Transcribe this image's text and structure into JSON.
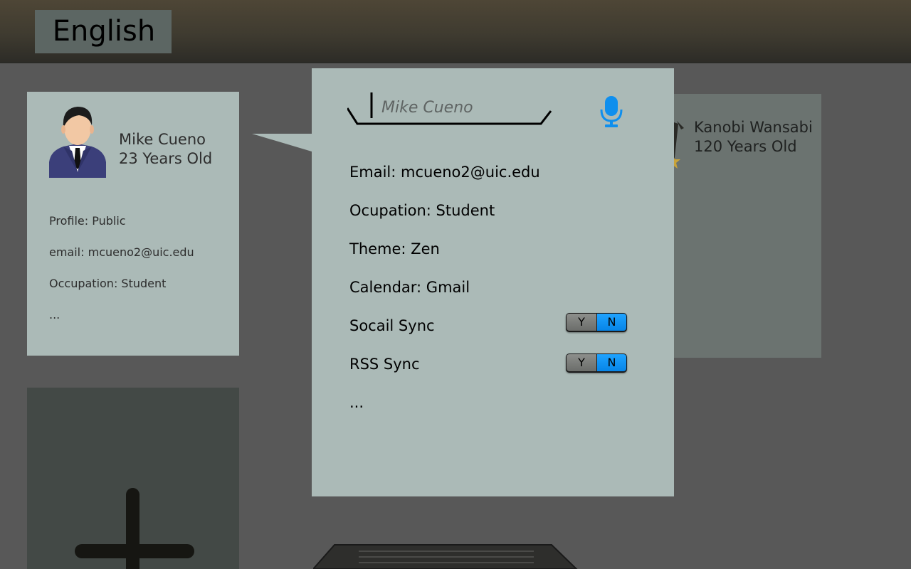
{
  "header": {
    "language_button": "English"
  },
  "user_card": {
    "name": "Mike Cueno",
    "age": "23 Years Old",
    "details": [
      "Profile: Public",
      "email: mcueno2@uic.edu",
      "Occupation: Student",
      "..."
    ]
  },
  "other_card": {
    "name": "Kanobi Wansabi",
    "age": "120 Years Old"
  },
  "edit_panel": {
    "name_input": {
      "placeholder": "Mike Cueno",
      "value": ""
    },
    "mic_icon": "microphone-icon",
    "fields": {
      "email": "Email: mcueno2@uic.edu",
      "occupation": "Ocupation: Student",
      "theme": "Theme: Zen",
      "calendar": "Calendar: Gmail",
      "more": "..."
    },
    "toggles": [
      {
        "label": "Socail Sync",
        "yes": "Y",
        "no": "N",
        "selected": "N"
      },
      {
        "label": "RSS Sync",
        "yes": "Y",
        "no": "N",
        "selected": "N"
      }
    ]
  },
  "add_card": {
    "icon": "plus-icon"
  },
  "colors": {
    "accent": "#0f8fee",
    "card": "#abbab7",
    "background": "#585858"
  }
}
